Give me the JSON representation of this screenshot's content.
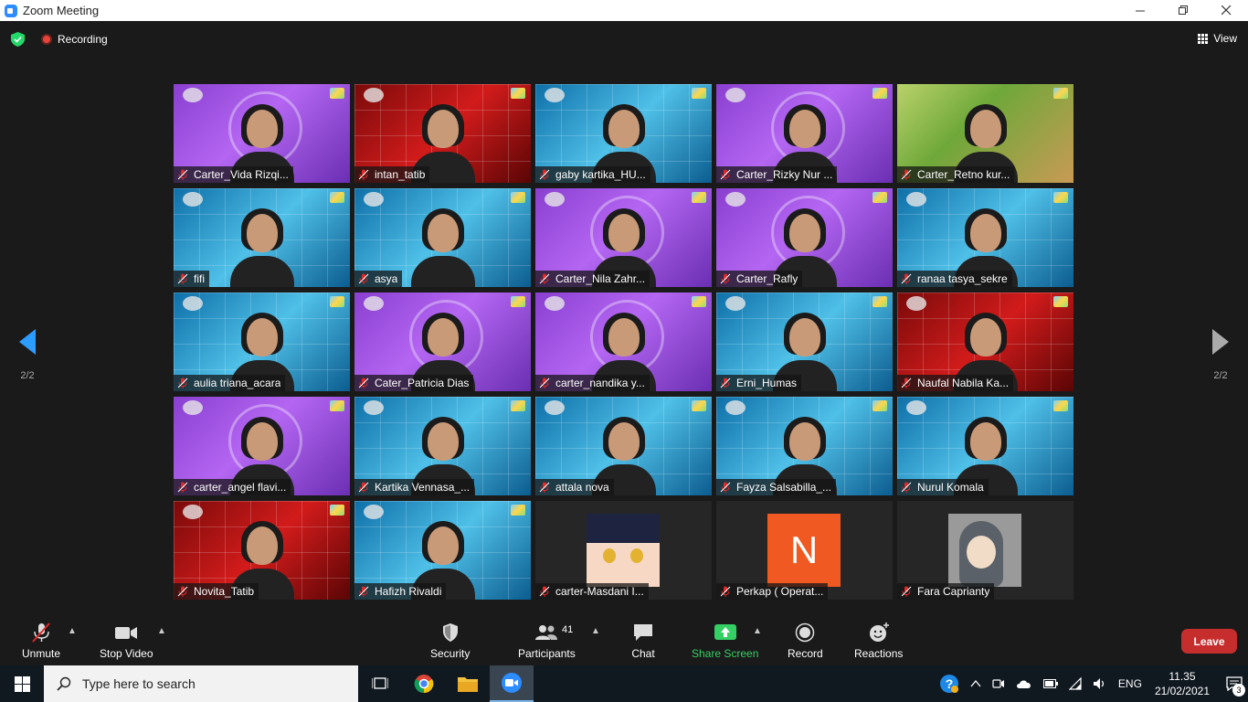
{
  "window": {
    "title": "Zoom Meeting"
  },
  "topbar": {
    "recording_label": "Recording",
    "view_label": "View"
  },
  "gallery": {
    "page": "2/2",
    "tiles": [
      {
        "name": "Carter_Vida Rizqi...",
        "bg": "purple",
        "kind": "video"
      },
      {
        "name": "intan_tatib",
        "bg": "red",
        "kind": "video"
      },
      {
        "name": "gaby kartika_HU...",
        "bg": "blue",
        "kind": "video"
      },
      {
        "name": "Carter_Rizky Nur ...",
        "bg": "purple",
        "kind": "video"
      },
      {
        "name": "Carter_Retno kur...",
        "bg": "room",
        "kind": "video"
      },
      {
        "name": "fifi",
        "bg": "blue",
        "kind": "video"
      },
      {
        "name": "asya",
        "bg": "blue",
        "kind": "video"
      },
      {
        "name": "Carter_Nila Zahr...",
        "bg": "purple",
        "kind": "video"
      },
      {
        "name": "Carter_Rafly",
        "bg": "purple",
        "kind": "video"
      },
      {
        "name": "ranaa tasya_sekre",
        "bg": "blue",
        "kind": "video"
      },
      {
        "name": "aulia triana_acara",
        "bg": "blue",
        "kind": "video"
      },
      {
        "name": "Cater_Patricia Dias",
        "bg": "purple",
        "kind": "video"
      },
      {
        "name": "carter_nandika y...",
        "bg": "purple",
        "kind": "video"
      },
      {
        "name": "Erni_Humas",
        "bg": "blue",
        "kind": "video"
      },
      {
        "name": "Naufal Nabila Ka...",
        "bg": "red",
        "kind": "video"
      },
      {
        "name": "carter_angel flavi...",
        "bg": "purple",
        "kind": "video"
      },
      {
        "name": "Kartika Vennasa_...",
        "bg": "blue",
        "kind": "video"
      },
      {
        "name": "attala nova",
        "bg": "blue",
        "kind": "video"
      },
      {
        "name": "Fayza Salsabilla_...",
        "bg": "blue",
        "kind": "video"
      },
      {
        "name": "Nurul Komala",
        "bg": "blue",
        "kind": "video"
      },
      {
        "name": "Novita_Tatib",
        "bg": "red",
        "kind": "video"
      },
      {
        "name": "Hafizh Rivaldi",
        "bg": "blue",
        "kind": "video"
      },
      {
        "name": "carter-Masdani I...",
        "bg": "dark",
        "kind": "avatar-anime"
      },
      {
        "name": "Perkap ( Operat...",
        "bg": "dark",
        "kind": "avatar-letter",
        "letter": "N"
      },
      {
        "name": "Fara Caprianty",
        "bg": "dark",
        "kind": "avatar-hijab"
      }
    ]
  },
  "toolbar": {
    "unmute": "Unmute",
    "stop_video": "Stop Video",
    "security": "Security",
    "participants": "Participants",
    "participants_count": "41",
    "chat": "Chat",
    "share_screen": "Share Screen",
    "record": "Record",
    "reactions": "Reactions",
    "leave": "Leave"
  },
  "taskbar": {
    "search_placeholder": "Type here to search",
    "language": "ENG",
    "time": "11.35",
    "date": "21/02/2021",
    "notification_count": "3"
  },
  "colors": {
    "accent": "#2d8cff",
    "leave": "#c62d2d",
    "share": "#35d063",
    "recording": "#e8443a"
  }
}
